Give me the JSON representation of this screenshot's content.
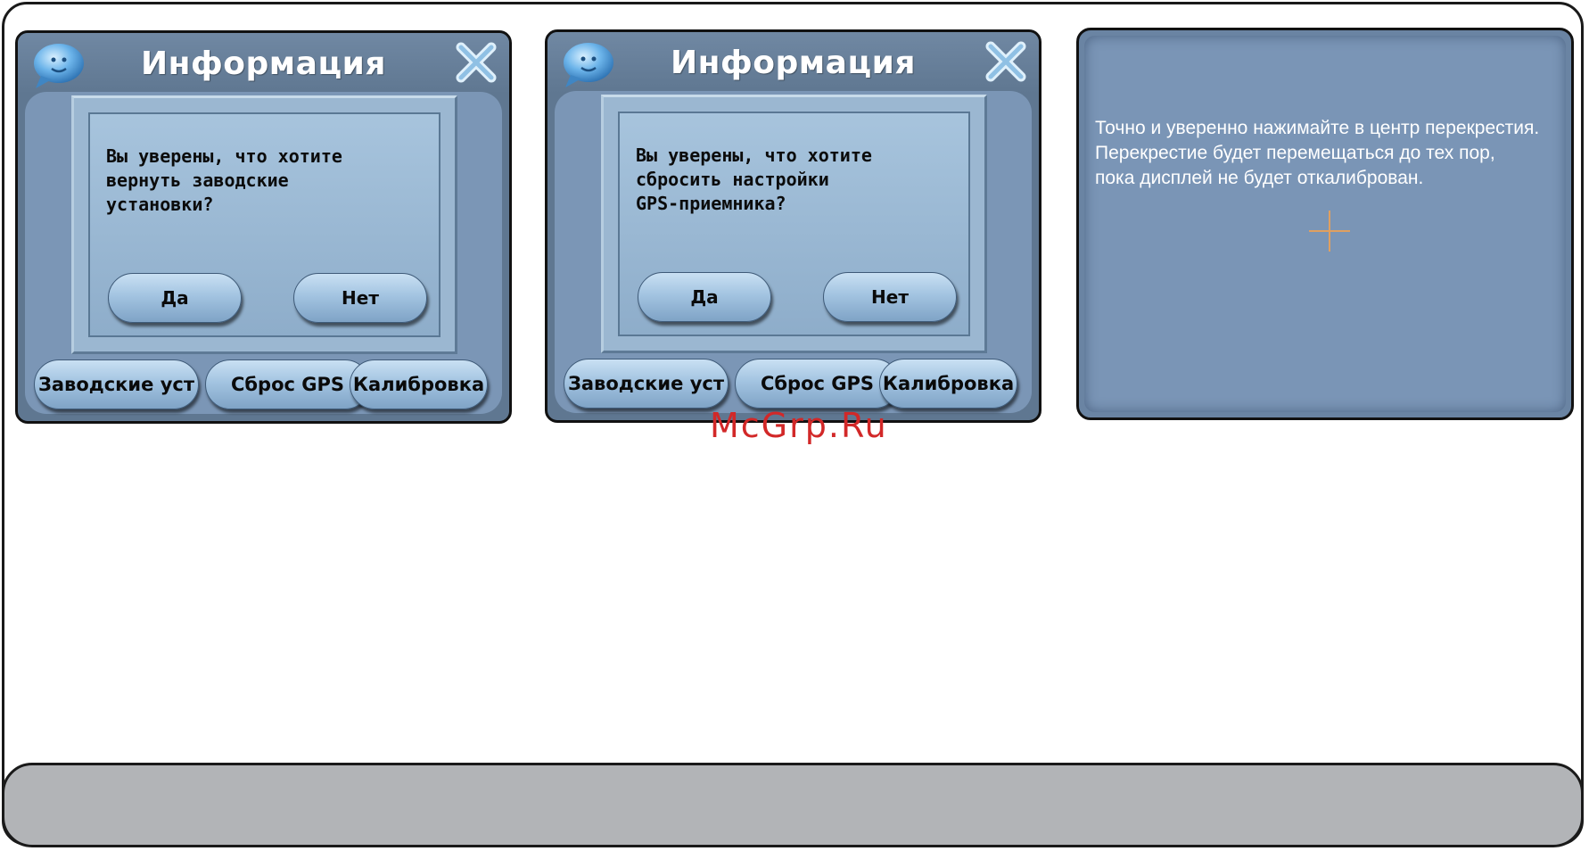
{
  "panels": [
    {
      "title": "Информация",
      "message": "Вы уверены, что хотите\nвернуть заводские\nустановки?",
      "yes_label": "Да",
      "no_label": "Нет",
      "tabs": [
        "Заводские уст",
        "Сброс GPS",
        "Калибровка"
      ]
    },
    {
      "title": "Информация",
      "message": "Вы уверены, что хотите\nсбросить настройки\nGPS-приемника?",
      "yes_label": "Да",
      "no_label": "Нет",
      "tabs": [
        "Заводские уст",
        "Сброс GPS",
        "Калибровка"
      ]
    }
  ],
  "calibration": {
    "instruction": "Точно и уверенно нажимайте в центр перекрестия.\nПерекрестие будет перемещаться до тех пор,\nпока дисплей не будет откалиброван.",
    "crosshair_color": "#e0a060"
  },
  "watermark": "McGrp.Ru",
  "colors": {
    "panel_bg": "#5f7791",
    "dialog_bg": "#9bb7d1",
    "button_bg": "#a3c4e1",
    "calib_bg": "#7a95b6",
    "watermark": "#d22828",
    "footer": "#b2b4b7"
  },
  "icons": [
    "chat-bubble-icon",
    "close-icon",
    "crosshair-icon"
  ]
}
